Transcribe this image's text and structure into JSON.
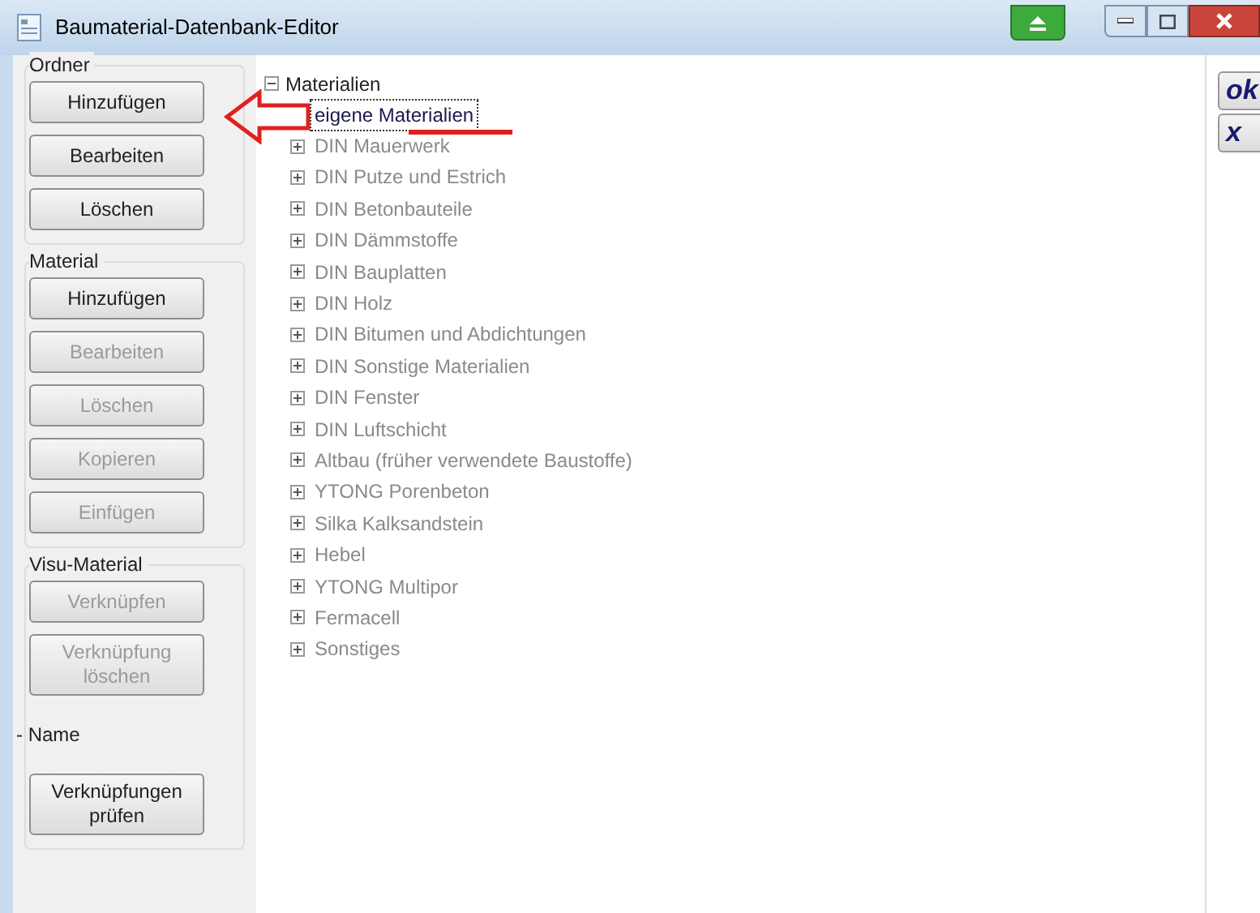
{
  "window": {
    "title": "Baumaterial-Datenbank-Editor"
  },
  "groups": [
    {
      "title": "Ordner",
      "items": [
        {
          "kind": "button",
          "label": "Hinzufügen",
          "disabled": false
        },
        {
          "kind": "button",
          "label": "Bearbeiten",
          "disabled": false
        },
        {
          "kind": "button",
          "label": "Löschen",
          "disabled": false
        }
      ]
    },
    {
      "title": "Material",
      "items": [
        {
          "kind": "button",
          "label": "Hinzufügen",
          "disabled": false
        },
        {
          "kind": "button",
          "label": "Bearbeiten",
          "disabled": true
        },
        {
          "kind": "button",
          "label": "Löschen",
          "disabled": true
        },
        {
          "kind": "button",
          "label": "Kopieren",
          "disabled": true
        },
        {
          "kind": "button",
          "label": "Einfügen",
          "disabled": true
        }
      ]
    },
    {
      "title": "Visu-Material",
      "items": [
        {
          "kind": "button",
          "label": "Verknüpfen",
          "disabled": true
        },
        {
          "kind": "button",
          "label": "Verknüpfung löschen",
          "disabled": true
        },
        {
          "kind": "label",
          "label": "- Name"
        },
        {
          "kind": "button",
          "label": "Verknüpfungen prüfen",
          "disabled": false
        }
      ]
    }
  ],
  "tree": {
    "label": "Materialien",
    "expanded": true,
    "children": [
      {
        "label": "eigene Materialien",
        "selected": true,
        "expandable": false
      },
      {
        "label": "DIN Mauerwerk",
        "selected": false,
        "expandable": true
      },
      {
        "label": "DIN Putze und Estrich",
        "selected": false,
        "expandable": true
      },
      {
        "label": "DIN Betonbauteile",
        "selected": false,
        "expandable": true
      },
      {
        "label": "DIN Dämmstoffe",
        "selected": false,
        "expandable": true
      },
      {
        "label": "DIN Bauplatten",
        "selected": false,
        "expandable": true
      },
      {
        "label": "DIN Holz",
        "selected": false,
        "expandable": true
      },
      {
        "label": "DIN Bitumen und Abdichtungen",
        "selected": false,
        "expandable": true
      },
      {
        "label": "DIN Sonstige Materialien",
        "selected": false,
        "expandable": true
      },
      {
        "label": "DIN Fenster",
        "selected": false,
        "expandable": true
      },
      {
        "label": "DIN Luftschicht",
        "selected": false,
        "expandable": true
      },
      {
        "label": "Altbau (früher verwendete Baustoffe)",
        "selected": false,
        "expandable": true
      },
      {
        "label": "YTONG Porenbeton",
        "selected": false,
        "expandable": true
      },
      {
        "label": "Silka Kalksandstein",
        "selected": false,
        "expandable": true
      },
      {
        "label": "Hebel",
        "selected": false,
        "expandable": true
      },
      {
        "label": "YTONG Multipor",
        "selected": false,
        "expandable": true
      },
      {
        "label": "Fermacell",
        "selected": false,
        "expandable": true
      },
      {
        "label": "Sonstiges",
        "selected": false,
        "expandable": true
      }
    ]
  },
  "side_buttons": [
    "ok",
    "x"
  ]
}
